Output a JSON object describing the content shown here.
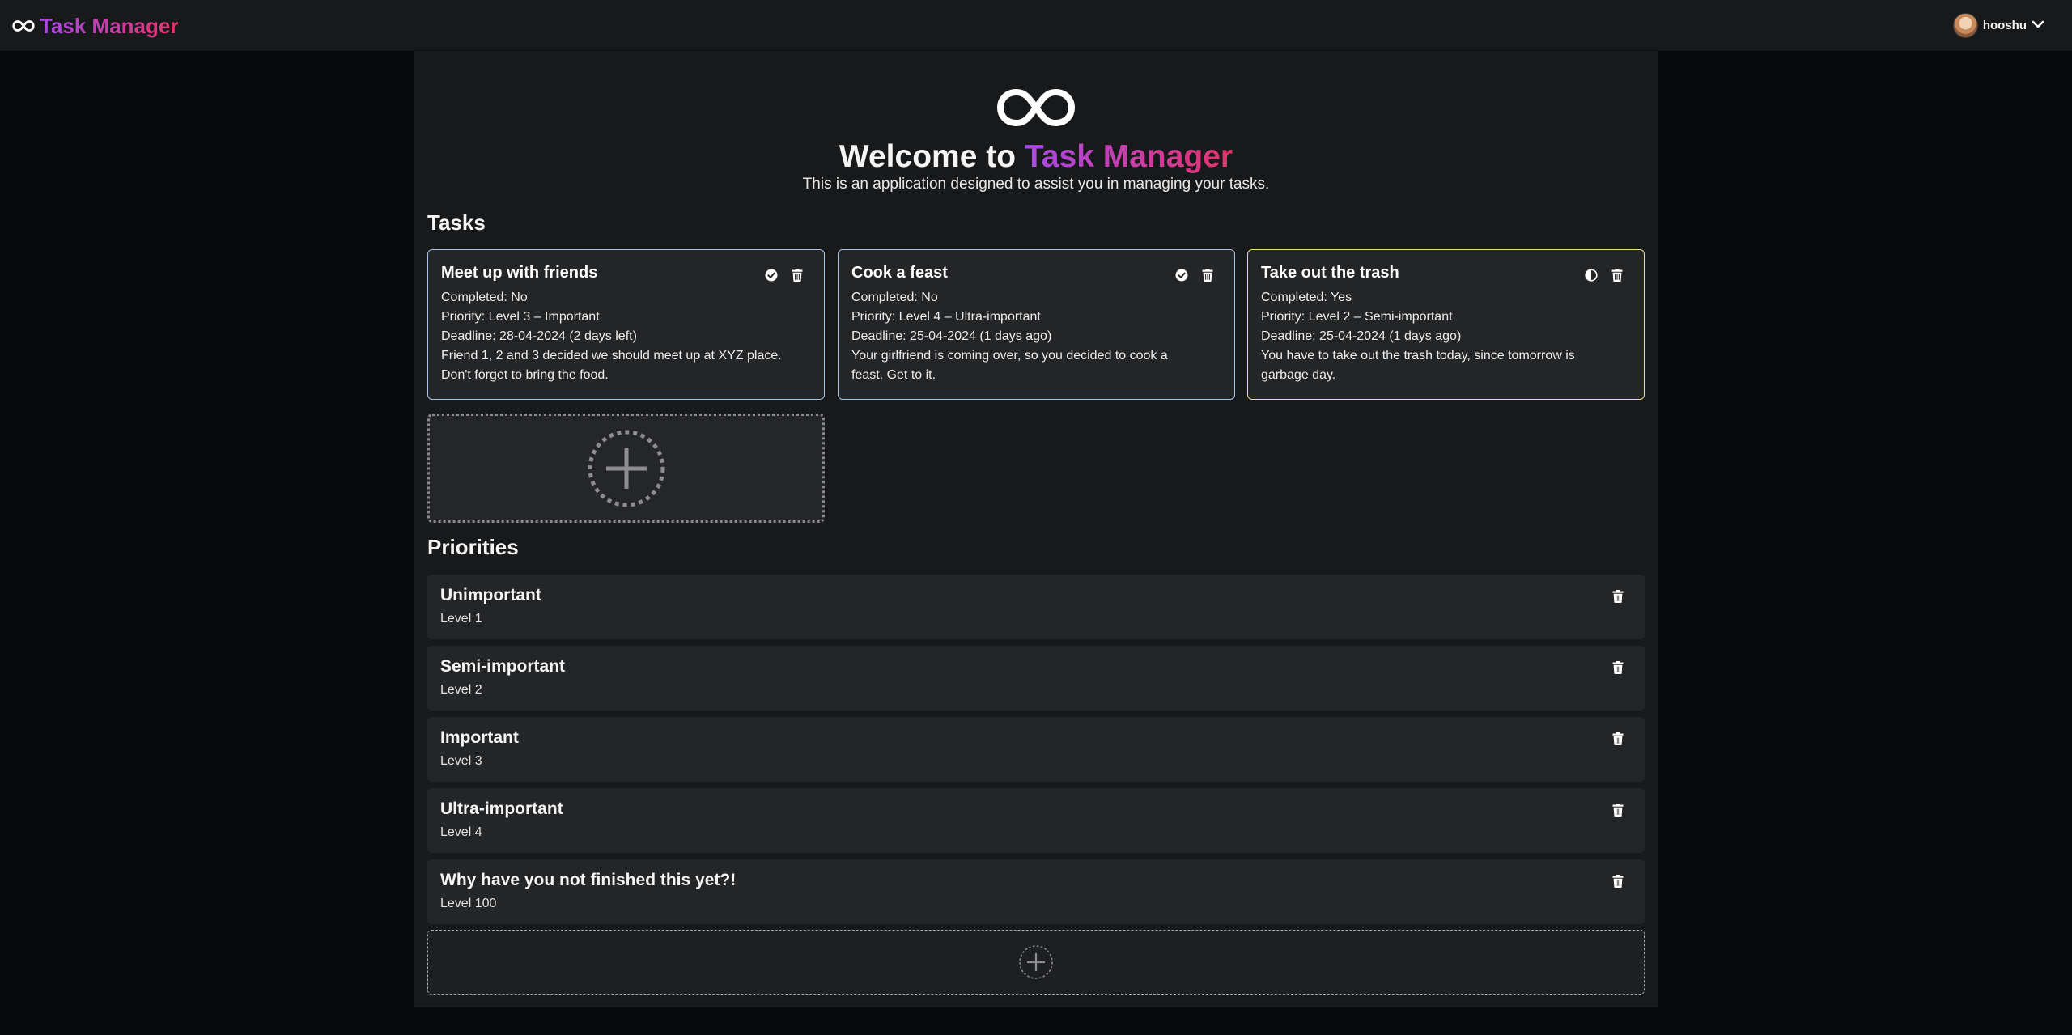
{
  "app": {
    "name": "Task Manager",
    "user": "hooshu"
  },
  "hero": {
    "title_prefix": "Welcome to ",
    "title_accent": "Task Manager",
    "subtitle": "This is an application designed to assist you in managing your tasks."
  },
  "tasks_section": {
    "title": "Tasks",
    "items": [
      {
        "title": "Meet up with friends",
        "completed": "Completed: No",
        "priority": "Priority: Level 3 – Important",
        "deadline": "Deadline: 28-04-2024 (2 days left)",
        "description_1": "Friend 1, 2 and 3 decided we should meet up at XYZ place.",
        "description_2": "Don't forget to bring the food.",
        "status_icon": "check-circle-icon",
        "border_color": "#a9c2ea"
      },
      {
        "title": "Cook a feast",
        "completed": "Completed: No",
        "priority": "Priority: Level 4 – Ultra-important",
        "deadline": "Deadline: 25-04-2024 (1 days ago)",
        "description_1": "Your girlfriend is coming over, so you decided to cook a",
        "description_2": "feast. Get to it.",
        "status_icon": "check-circle-icon",
        "border_color": "#a9c2ea"
      },
      {
        "title": "Take out the trash",
        "completed": "Completed: Yes",
        "priority": "Priority: Level 2 – Semi-important",
        "deadline": "Deadline: 25-04-2024 (1 days ago)",
        "description_1": "You have to take out the trash today, since tomorrow is",
        "description_2": "garbage day.",
        "status_icon": "half-circle-icon",
        "border_color": "#e9dd8e"
      }
    ]
  },
  "priorities_section": {
    "title": "Priorities",
    "items": [
      {
        "name": "Unimportant",
        "level": "Level 1"
      },
      {
        "name": "Semi-important",
        "level": "Level 2"
      },
      {
        "name": "Important",
        "level": "Level 3"
      },
      {
        "name": "Ultra-important",
        "level": "Level 4"
      },
      {
        "name": "Why have you not finished this yet?!",
        "level": "Level 100"
      }
    ]
  },
  "colors": {
    "accent_start": "#a64ae8",
    "accent_end": "#e5336a",
    "card_border": "#a9c2ea",
    "card_border_completed": "#e9dd8e"
  }
}
